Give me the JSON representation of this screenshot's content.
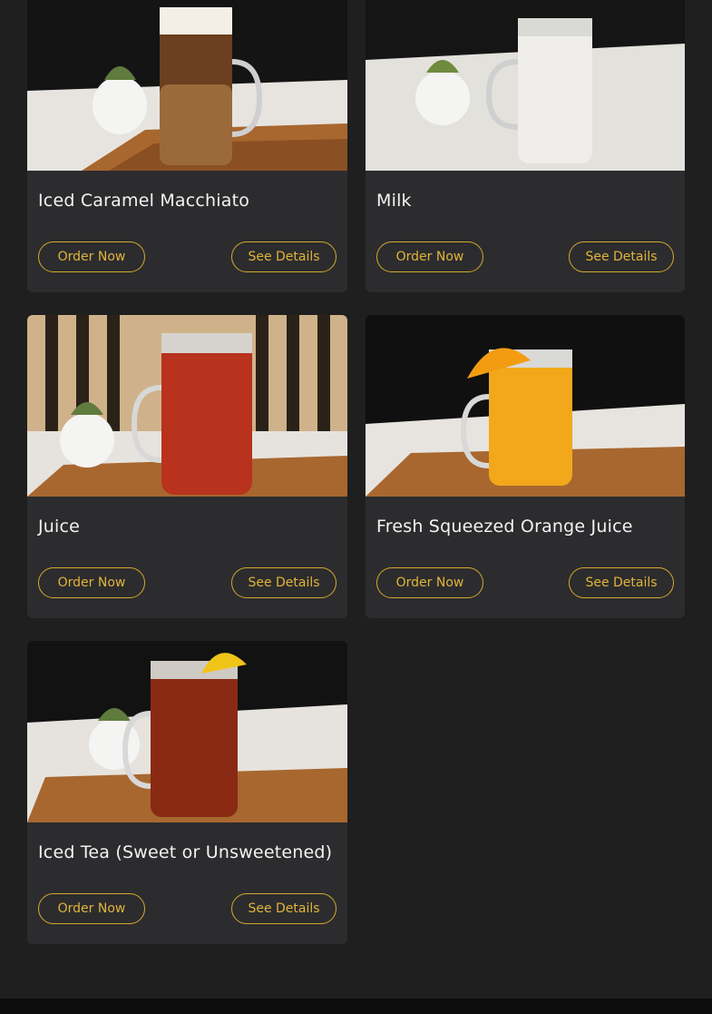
{
  "products": [
    {
      "name": "Iced Caramel Macchiato",
      "order_label": "Order Now",
      "details_label": "See Details",
      "drink_color": "#7a4a26",
      "bg_style": "dark-top"
    },
    {
      "name": "Milk",
      "order_label": "Order Now",
      "details_label": "See Details",
      "drink_color": "#ecebe6",
      "bg_style": "dark-top"
    },
    {
      "name": "Juice",
      "order_label": "Order Now",
      "details_label": "See Details",
      "drink_color": "#b8321e",
      "bg_style": "slats"
    },
    {
      "name": "Fresh Squeezed Orange Juice",
      "order_label": "Order Now",
      "details_label": "See Details",
      "drink_color": "#f2a81a",
      "bg_style": "dark-top"
    },
    {
      "name": "Iced Tea (Sweet or Unsweetened)",
      "order_label": "Order Now",
      "details_label": "See Details",
      "drink_color": "#8a2a14",
      "bg_style": "dark-top"
    }
  ],
  "colors": {
    "page_bg": "#1f1f20",
    "card_bg": "#2c2c2e",
    "accent": "#d5a82b"
  }
}
